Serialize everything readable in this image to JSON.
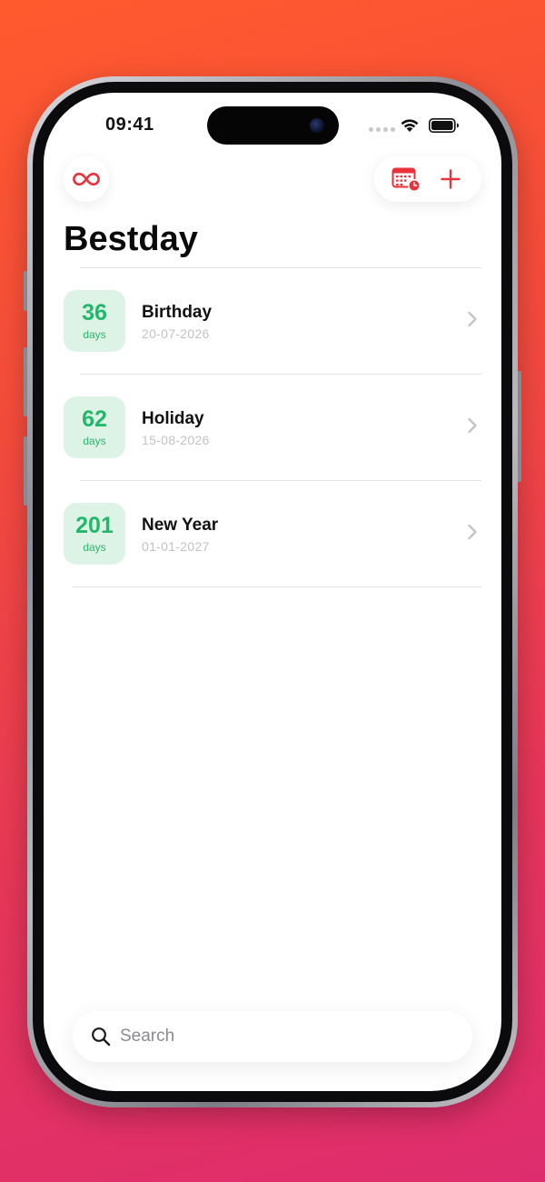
{
  "status_bar": {
    "time": "09:41"
  },
  "header": {
    "title": "Bestday",
    "left_icon": "infinity-icon",
    "right_icons": [
      "calendar-clock-icon",
      "plus-icon"
    ]
  },
  "events": [
    {
      "days": "36",
      "unit": "days",
      "name": "Birthday",
      "date": "20-07-2026"
    },
    {
      "days": "62",
      "unit": "days",
      "name": "Holiday",
      "date": "15-08-2026"
    },
    {
      "days": "201",
      "unit": "days",
      "name": "New Year",
      "date": "01-01-2027"
    }
  ],
  "search": {
    "placeholder": "Search"
  },
  "colors": {
    "accent": "#e8323c",
    "badge_bg": "#dcf3e6",
    "badge_text": "#22b86a"
  }
}
